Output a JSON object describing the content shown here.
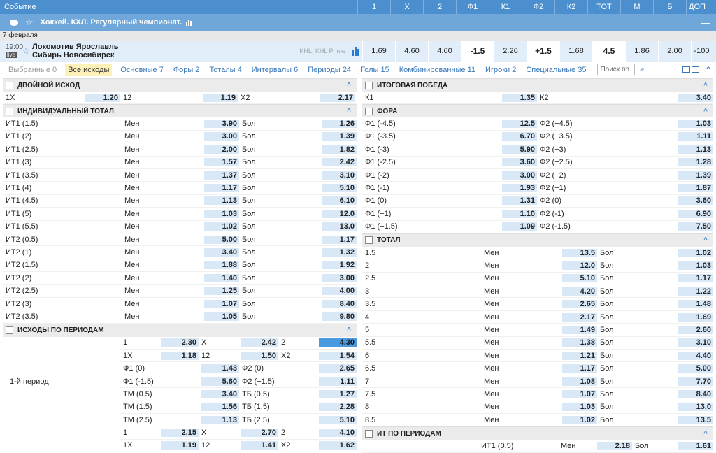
{
  "header": {
    "event": "Событие",
    "cols": [
      "1",
      "X",
      "2",
      "Ф1",
      "К1",
      "Ф2",
      "К2",
      "ТОТ",
      "М",
      "Б",
      "ДОП"
    ]
  },
  "league": {
    "title": "Хоккей. КХЛ. Регулярный чемпионат.",
    "collapse": "—"
  },
  "date": "7 февраля",
  "match": {
    "time": "19:00",
    "live": "live",
    "team1": "Локомотив Ярославль",
    "team2": "Сибирь Новосибирск",
    "league_tag": "KHL, KHL Prime",
    "odds": [
      "1.69",
      "4.60",
      "4.60",
      "-1.5",
      "2.26",
      "+1.5",
      "1.68",
      "4.5",
      "1.86",
      "2.00",
      "-100"
    ]
  },
  "tabs": [
    "Выбранные 0",
    "Все исходы",
    "Основные 7",
    "Форы 2",
    "Тоталы 4",
    "Интервалы 6",
    "Периоды 24",
    "Голы 15",
    "Комбинированные 11",
    "Игроки 2",
    "Специальные 35"
  ],
  "search": {
    "placeholder": "Поиск по..."
  },
  "left": {
    "double": {
      "title": "ДВОЙНОЙ ИСХОД",
      "row": [
        [
          "1X",
          "1.20"
        ],
        [
          "12",
          "1.19"
        ],
        [
          "X2",
          "2.17"
        ]
      ]
    },
    "indiv": {
      "title": "ИНДИВИДУАЛЬНЫЙ ТОТАЛ",
      "rows": [
        [
          "ИТ1 (1.5)",
          "Мен",
          "3.90",
          "Бол",
          "1.26"
        ],
        [
          "ИТ1 (2)",
          "Мен",
          "3.00",
          "Бол",
          "1.39"
        ],
        [
          "ИТ1 (2.5)",
          "Мен",
          "2.00",
          "Бол",
          "1.82"
        ],
        [
          "ИТ1 (3)",
          "Мен",
          "1.57",
          "Бол",
          "2.42"
        ],
        [
          "ИТ1 (3.5)",
          "Мен",
          "1.37",
          "Бол",
          "3.10"
        ],
        [
          "ИТ1 (4)",
          "Мен",
          "1.17",
          "Бол",
          "5.10"
        ],
        [
          "ИТ1 (4.5)",
          "Мен",
          "1.13",
          "Бол",
          "6.10"
        ],
        [
          "ИТ1 (5)",
          "Мен",
          "1.03",
          "Бол",
          "12.0"
        ],
        [
          "ИТ1 (5.5)",
          "Мен",
          "1.02",
          "Бол",
          "13.0"
        ],
        [
          "ИТ2 (0.5)",
          "Мен",
          "5.00",
          "Бол",
          "1.17"
        ],
        [
          "ИТ2 (1)",
          "Мен",
          "3.40",
          "Бол",
          "1.32"
        ],
        [
          "ИТ2 (1.5)",
          "Мен",
          "1.88",
          "Бол",
          "1.92"
        ],
        [
          "ИТ2 (2)",
          "Мен",
          "1.40",
          "Бол",
          "3.00"
        ],
        [
          "ИТ2 (2.5)",
          "Мен",
          "1.25",
          "Бол",
          "4.00"
        ],
        [
          "ИТ2 (3)",
          "Мен",
          "1.07",
          "Бол",
          "8.40"
        ],
        [
          "ИТ2 (3.5)",
          "Мен",
          "1.05",
          "Бол",
          "9.80"
        ]
      ]
    },
    "periods": {
      "title": "ИСХОДЫ ПО ПЕРИОДАМ",
      "label": "1-й период",
      "rows": [
        [
          "1",
          "2.30",
          "X",
          "2.42",
          "2",
          "4.30"
        ],
        [
          "1X",
          "1.18",
          "12",
          "1.50",
          "X2",
          "1.54"
        ],
        [
          "Ф1 (0)",
          "1.43",
          "Ф2 (0)",
          "2.65"
        ],
        [
          "Ф1 (-1.5)",
          "5.60",
          "Ф2 (+1.5)",
          "1.11"
        ],
        [
          "ТМ (0.5)",
          "3.40",
          "ТБ (0.5)",
          "1.27"
        ],
        [
          "ТМ (1.5)",
          "1.56",
          "ТБ (1.5)",
          "2.28"
        ],
        [
          "ТМ (2.5)",
          "1.13",
          "ТБ (2.5)",
          "5.10"
        ]
      ],
      "rows2": [
        [
          "1",
          "2.15",
          "X",
          "2.70",
          "2",
          "4.10"
        ],
        [
          "1X",
          "1.19",
          "12",
          "1.41",
          "X2",
          "1.62"
        ]
      ]
    }
  },
  "right": {
    "win": {
      "title": "ИТОГОВАЯ ПОБЕДА",
      "row": [
        [
          "К1",
          "1.35"
        ],
        [
          "К2",
          "3.40"
        ]
      ]
    },
    "fora": {
      "title": "ФОРА",
      "rows": [
        [
          "Ф1 (-4.5)",
          "12.5",
          "Ф2 (+4.5)",
          "1.03"
        ],
        [
          "Ф1 (-3.5)",
          "6.70",
          "Ф2 (+3.5)",
          "1.11"
        ],
        [
          "Ф1 (-3)",
          "5.90",
          "Ф2 (+3)",
          "1.13"
        ],
        [
          "Ф1 (-2.5)",
          "3.60",
          "Ф2 (+2.5)",
          "1.28"
        ],
        [
          "Ф1 (-2)",
          "3.00",
          "Ф2 (+2)",
          "1.39"
        ],
        [
          "Ф1 (-1)",
          "1.93",
          "Ф2 (+1)",
          "1.87"
        ],
        [
          "Ф1 (0)",
          "1.31",
          "Ф2 (0)",
          "3.60"
        ],
        [
          "Ф1 (+1)",
          "1.10",
          "Ф2 (-1)",
          "6.90"
        ],
        [
          "Ф1 (+1.5)",
          "1.09",
          "Ф2 (-1.5)",
          "7.50"
        ]
      ]
    },
    "total": {
      "title": "ТОТАЛ",
      "rows": [
        [
          "1.5",
          "Мен",
          "13.5",
          "Бол",
          "1.02"
        ],
        [
          "2",
          "Мен",
          "12.0",
          "Бол",
          "1.03"
        ],
        [
          "2.5",
          "Мен",
          "5.10",
          "Бол",
          "1.17"
        ],
        [
          "3",
          "Мен",
          "4.20",
          "Бол",
          "1.22"
        ],
        [
          "3.5",
          "Мен",
          "2.65",
          "Бол",
          "1.48"
        ],
        [
          "4",
          "Мен",
          "2.17",
          "Бол",
          "1.69"
        ],
        [
          "5",
          "Мен",
          "1.49",
          "Бол",
          "2.60"
        ],
        [
          "5.5",
          "Мен",
          "1.38",
          "Бол",
          "3.10"
        ],
        [
          "6",
          "Мен",
          "1.21",
          "Бол",
          "4.40"
        ],
        [
          "6.5",
          "Мен",
          "1.17",
          "Бол",
          "5.00"
        ],
        [
          "7",
          "Мен",
          "1.08",
          "Бол",
          "7.70"
        ],
        [
          "7.5",
          "Мен",
          "1.07",
          "Бол",
          "8.40"
        ],
        [
          "8",
          "Мен",
          "1.03",
          "Бол",
          "13.0"
        ],
        [
          "8.5",
          "Мен",
          "1.02",
          "Бол",
          "13.5"
        ]
      ]
    },
    "itp": {
      "title": "ИТ ПО ПЕРИОДАМ",
      "rows": [
        [
          "ИТ1 (0.5)",
          "Мен",
          "2.18",
          "Бол",
          "1.61"
        ]
      ]
    }
  }
}
